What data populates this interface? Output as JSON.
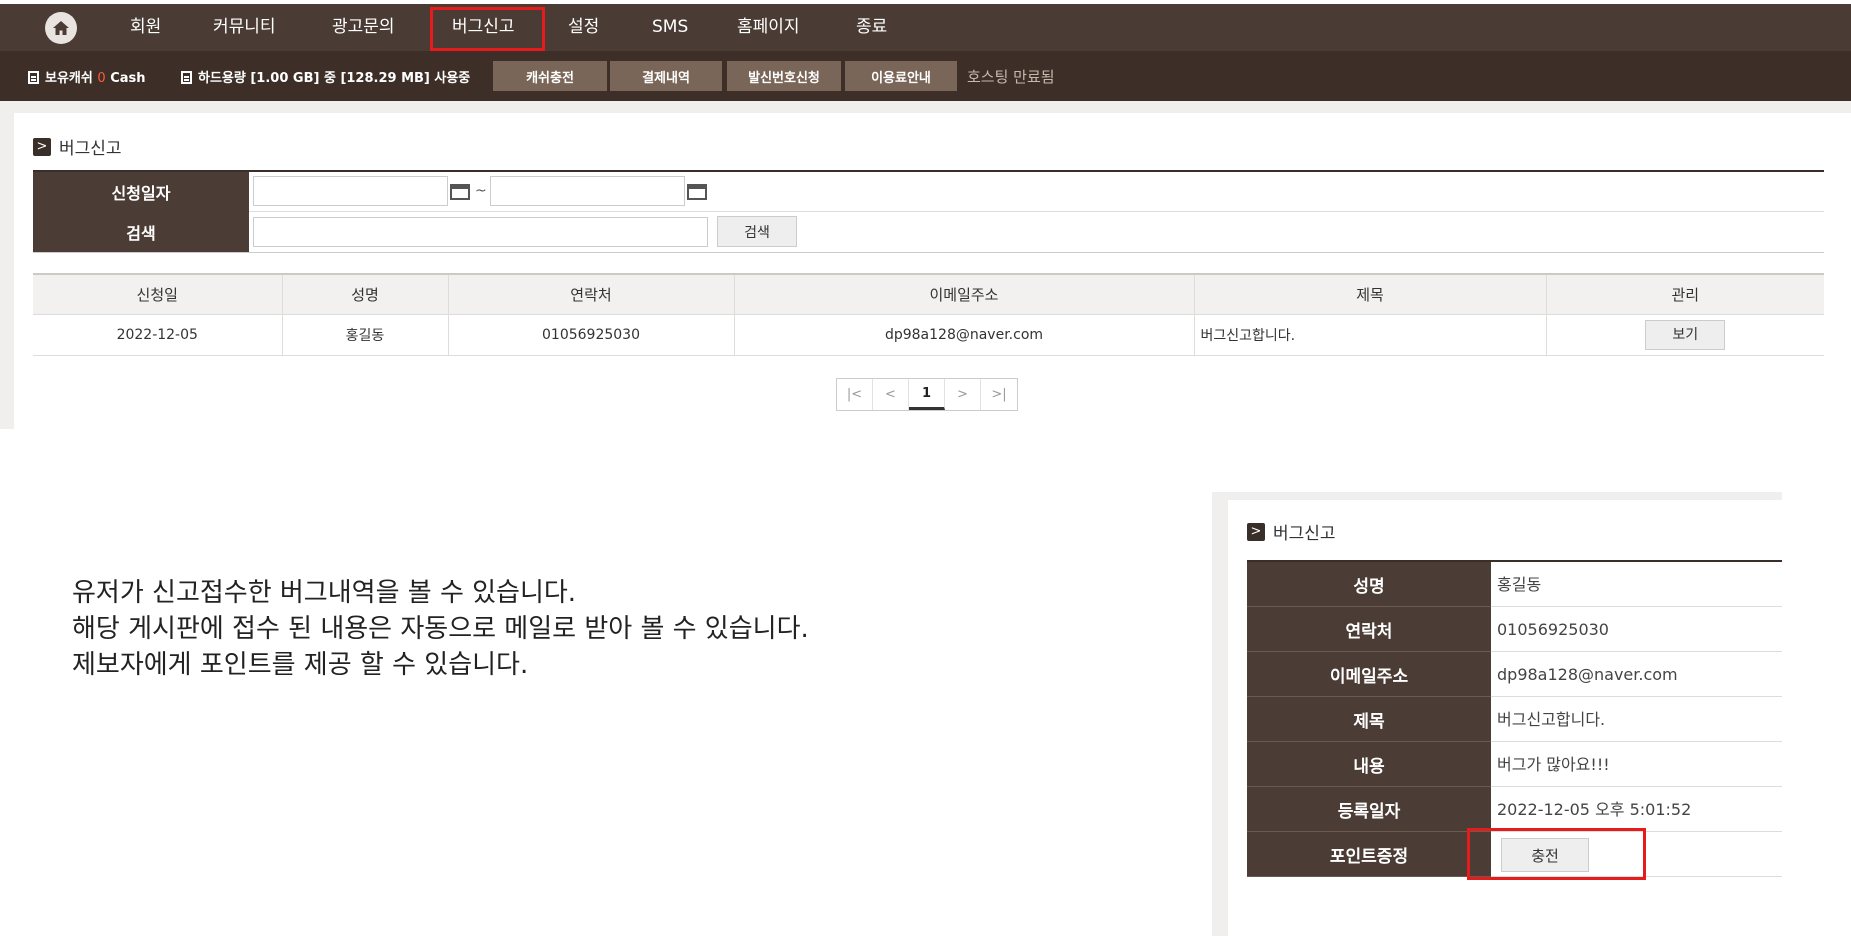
{
  "nav": {
    "home_icon": "home-icon",
    "items": [
      {
        "label": "회원"
      },
      {
        "label": "커뮤니티"
      },
      {
        "label": "광고문의"
      },
      {
        "label": "버그신고"
      },
      {
        "label": "설정"
      },
      {
        "label": "SMS"
      },
      {
        "label": "홈페이지"
      },
      {
        "label": "종료"
      }
    ],
    "highlight_color": "#e61c1c"
  },
  "subbar": {
    "cash_label": "보유캐쉬",
    "cash_value": "0",
    "cash_unit": "Cash",
    "disk_label": "하드용량 [1.00 GB] 중 [128.29 MB] 사용중",
    "buttons": [
      "캐쉬충전",
      "결제내역",
      "발신번호신청",
      "이용료안내"
    ],
    "hosting_status": "호스팅 만료됨"
  },
  "list_section": {
    "title": "버그신고",
    "search": {
      "date_label": "신청일자",
      "date_from": "",
      "tilde": "~",
      "date_to": "",
      "keyword_label": "검색",
      "keyword_value": "",
      "search_button": "검색"
    },
    "columns": [
      "신청일",
      "성명",
      "연락처",
      "이메일주소",
      "제목",
      "관리"
    ],
    "rows": [
      {
        "date": "2022-12-05",
        "name": "홍길동",
        "phone": "01056925030",
        "email": "dp98a128@naver.com",
        "title": "버그신고합니다.",
        "action": "보기"
      }
    ],
    "pagination": {
      "first": "|<",
      "prev": "<",
      "current": "1",
      "next": ">",
      "last": ">|"
    }
  },
  "description": {
    "lines": [
      "유저가 신고접수한 버그내역을 볼 수 있습니다.",
      "해당 게시판에 접수 된 내용은 자동으로 메일로 받아 볼 수 있습니다.",
      "제보자에게 포인트를 제공 할 수 있습니다."
    ]
  },
  "detail_section": {
    "title": "버그신고",
    "fields": [
      {
        "label": "성명",
        "value": "홍길동"
      },
      {
        "label": "연락처",
        "value": "01056925030"
      },
      {
        "label": "이메일주소",
        "value": "dp98a128@naver.com"
      },
      {
        "label": "제목",
        "value": "버그신고합니다."
      },
      {
        "label": "내용",
        "value": "버그가 많아요!!!"
      },
      {
        "label": "등록일자",
        "value": "2022-12-05 오후 5:01:52"
      }
    ],
    "point_label": "포인트증정",
    "charge_button": "충전"
  }
}
